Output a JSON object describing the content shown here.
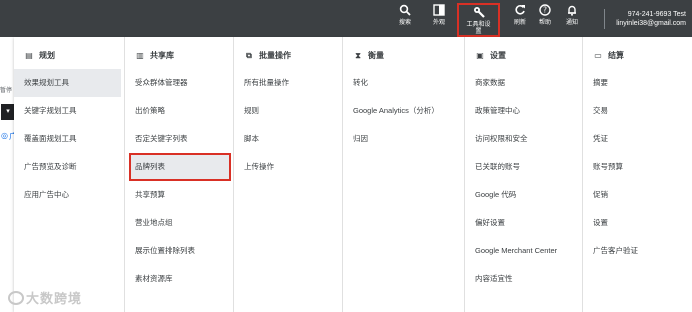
{
  "topbar": {
    "items": [
      {
        "label": "搜索",
        "icon": "search-icon"
      },
      {
        "label": "外观",
        "icon": "appearance-icon"
      },
      {
        "label": "工具和设置",
        "icon": "wrench-icon"
      },
      {
        "label": "刷新",
        "icon": "refresh-icon"
      },
      {
        "label": "帮助",
        "icon": "help-icon"
      },
      {
        "label": "通知",
        "icon": "bell-icon"
      }
    ],
    "tools_label_line1": "工具和设",
    "tools_label_line2": "置",
    "account_line1": "974-241-9693 Test",
    "account_line2": "linyinlei38@gmail.com"
  },
  "leftstrip": {
    "text": "暂停",
    "black_glyph": "▾",
    "link_label": "广"
  },
  "menu": {
    "columns": [
      {
        "title": "规划",
        "icon": "calendar-icon",
        "items": [
          "效果规划工具",
          "关键字规划工具",
          "覆盖面规划工具",
          "广告预览及诊断",
          "应用广告中心"
        ]
      },
      {
        "title": "共享库",
        "icon": "library-icon",
        "items": [
          "受众群体管理器",
          "出价策略",
          "否定关键字列表",
          "品牌列表",
          "共享预算",
          "营业地点组",
          "展示位置排除列表",
          "素材资源库"
        ]
      },
      {
        "title": "批量操作",
        "icon": "copy-icon",
        "items": [
          "所有批量操作",
          "规则",
          "脚本",
          "上传操作"
        ]
      },
      {
        "title": "衡量",
        "icon": "hourglass-icon",
        "items": [
          "转化",
          "Google Analytics（分析）",
          "归因"
        ]
      },
      {
        "title": "设置",
        "icon": "settings-icon",
        "items": [
          "商家数据",
          "政策管理中心",
          "访问权限和安全",
          "已关联的账号",
          "Google 代码",
          "偏好设置",
          "Google Merchant Center",
          "内容适宜性"
        ]
      },
      {
        "title": "结算",
        "icon": "credit-card-icon",
        "items": [
          "摘要",
          "交易",
          "凭证",
          "账号预算",
          "促销",
          "设置",
          "广告客户验证"
        ]
      }
    ],
    "active_item": "效果规划工具",
    "highlighted_item": "品牌列表"
  },
  "watermark": {
    "text": "大数跨境"
  },
  "colors": {
    "topbar_bg": "#3c4043",
    "highlight_border": "#d93025",
    "active_bg": "#e8eaed"
  }
}
